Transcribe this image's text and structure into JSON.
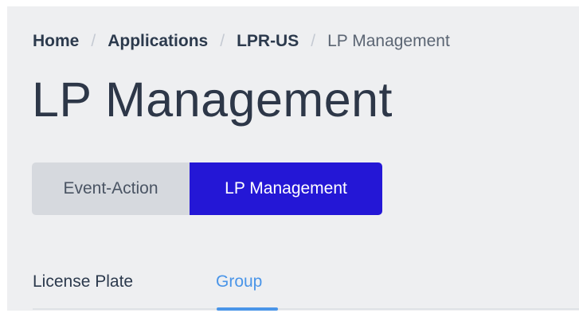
{
  "breadcrumb": {
    "items": [
      {
        "label": "Home"
      },
      {
        "label": "Applications"
      },
      {
        "label": "LPR-US"
      }
    ],
    "separator": "/",
    "current": "LP Management"
  },
  "page": {
    "title": "LP Management"
  },
  "mode_switch": {
    "options": [
      {
        "label": "Event-Action",
        "selected": false
      },
      {
        "label": "LP Management",
        "selected": true
      }
    ]
  },
  "tabs": {
    "items": [
      {
        "label": "License Plate",
        "selected": false
      },
      {
        "label": "Group",
        "selected": true
      }
    ]
  },
  "colors": {
    "background": "#eeeff1",
    "title_text": "#2d3748",
    "active_segment": "#2417d6",
    "inactive_segment": "#d6d9de",
    "active_tab": "#4a95e8"
  }
}
